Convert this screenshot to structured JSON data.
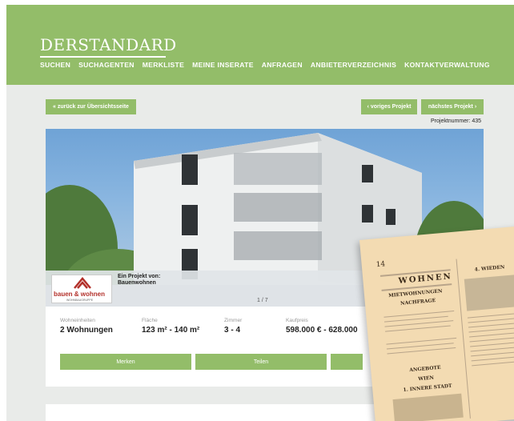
{
  "header": {
    "logo_text": "DERSTANDARD",
    "nav": [
      "SUCHEN",
      "SUCHAGENTEN",
      "MERKLISTE",
      "MEINE INSERATE",
      "ANFRAGEN",
      "ANBIETERVERZEICHNIS",
      "KONTAKTVERWALTUNG"
    ]
  },
  "toolbar": {
    "back_label": "« zurück zur Übersichtsseite",
    "prev_label": "‹ voriges Projekt",
    "next_label": "nächstes Projekt ›",
    "project_number": "Projektnummer: 435"
  },
  "gallery": {
    "counter": "1 / 7"
  },
  "provider": {
    "label": "Ein Projekt von:",
    "name": "Bauenwohnen",
    "logo_text": "bauen & wohnen",
    "logo_subtext": "WOHNBAUGRUPPE"
  },
  "stats": [
    {
      "label": "Wohneinheiten",
      "value": "2 Wohnungen"
    },
    {
      "label": "Fläche",
      "value": "123 m² - 140 m²"
    },
    {
      "label": "Zimmer",
      "value": "3 - 4"
    },
    {
      "label": "Kaufpreis",
      "value": "598.000 € - 628.000"
    }
  ],
  "actions": {
    "save": "Merken",
    "share": "Teilen"
  },
  "newspaper": {
    "page_number": "14",
    "heading": "WOHNEN",
    "sub1": "MIETWOHNUNGEN",
    "sub2": "NACHFRAGE",
    "sub3": "ANGEBOTE",
    "sub4": "WIEN",
    "sub5": "1. INNERE STADT",
    "right_header": "4. WIEDEN"
  },
  "colors": {
    "brand_green": "#93bd69",
    "background": "#e9ebe9"
  }
}
